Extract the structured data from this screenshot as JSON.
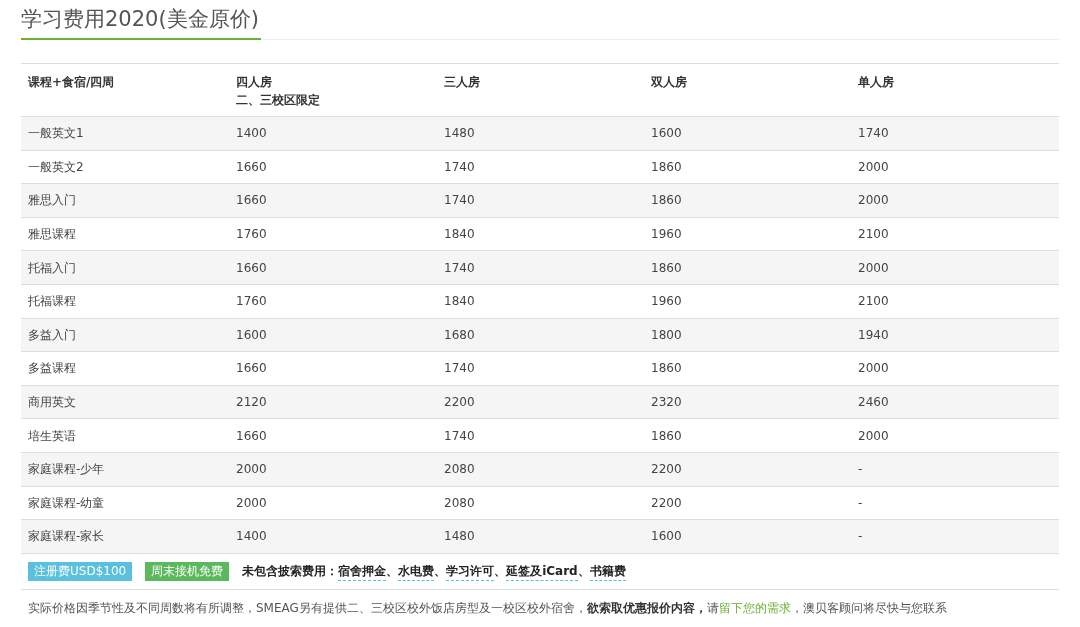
{
  "title": "学习费用2020(美金原价)",
  "table": {
    "columns": [
      {
        "label": "课程+食宿/四周"
      },
      {
        "label": "四人房",
        "note": "二、三校区限定"
      },
      {
        "label": "三人房"
      },
      {
        "label": "双人房"
      },
      {
        "label": "单人房"
      }
    ],
    "rows": [
      [
        "一般英文1",
        "1400",
        "1480",
        "1600",
        "1740"
      ],
      [
        "一般英文2",
        "1660",
        "1740",
        "1860",
        "2000"
      ],
      [
        "雅思入门",
        "1660",
        "1740",
        "1860",
        "2000"
      ],
      [
        "雅思课程",
        "1760",
        "1840",
        "1960",
        "2100"
      ],
      [
        "托福入门",
        "1660",
        "1740",
        "1860",
        "2000"
      ],
      [
        "托福课程",
        "1760",
        "1840",
        "1960",
        "2100"
      ],
      [
        "多益入门",
        "1600",
        "1680",
        "1800",
        "1940"
      ],
      [
        "多益课程",
        "1660",
        "1740",
        "1860",
        "2000"
      ],
      [
        "商用英文",
        "2120",
        "2200",
        "2320",
        "2460"
      ],
      [
        "培生英语",
        "1660",
        "1740",
        "1860",
        "2000"
      ],
      [
        "家庭课程-少年",
        "2000",
        "2080",
        "2200",
        "-"
      ],
      [
        "家庭课程-幼童",
        "2000",
        "2080",
        "2200",
        "-"
      ],
      [
        "家庭课程-家长",
        "1400",
        "1480",
        "1600",
        "-"
      ]
    ]
  },
  "badges": [
    {
      "text": "注册费USD$100",
      "color": "#5bc0de"
    },
    {
      "text": "周末接机免费",
      "color": "#5cb85c"
    }
  ],
  "fees": {
    "label": "未包含披索费用：",
    "items": [
      {
        "text": "宿舍押金",
        "separator": "、"
      },
      {
        "text": "水电费",
        "separator": "、"
      },
      {
        "text": "学习许可",
        "separator": "、"
      },
      {
        "text": "延签及iCard",
        "separator": "、"
      },
      {
        "text": "书籍费"
      }
    ]
  },
  "note": {
    "before": "实际价格因季节性及不同周数将有所调整，SMEAG另有提供二、三校区校外饭店房型及一校区校外宿舍，**欲索取优惠报价内容，**请",
    "link": "留下您的需求",
    "after": "，澳贝客顾问将尽快与您联系"
  }
}
